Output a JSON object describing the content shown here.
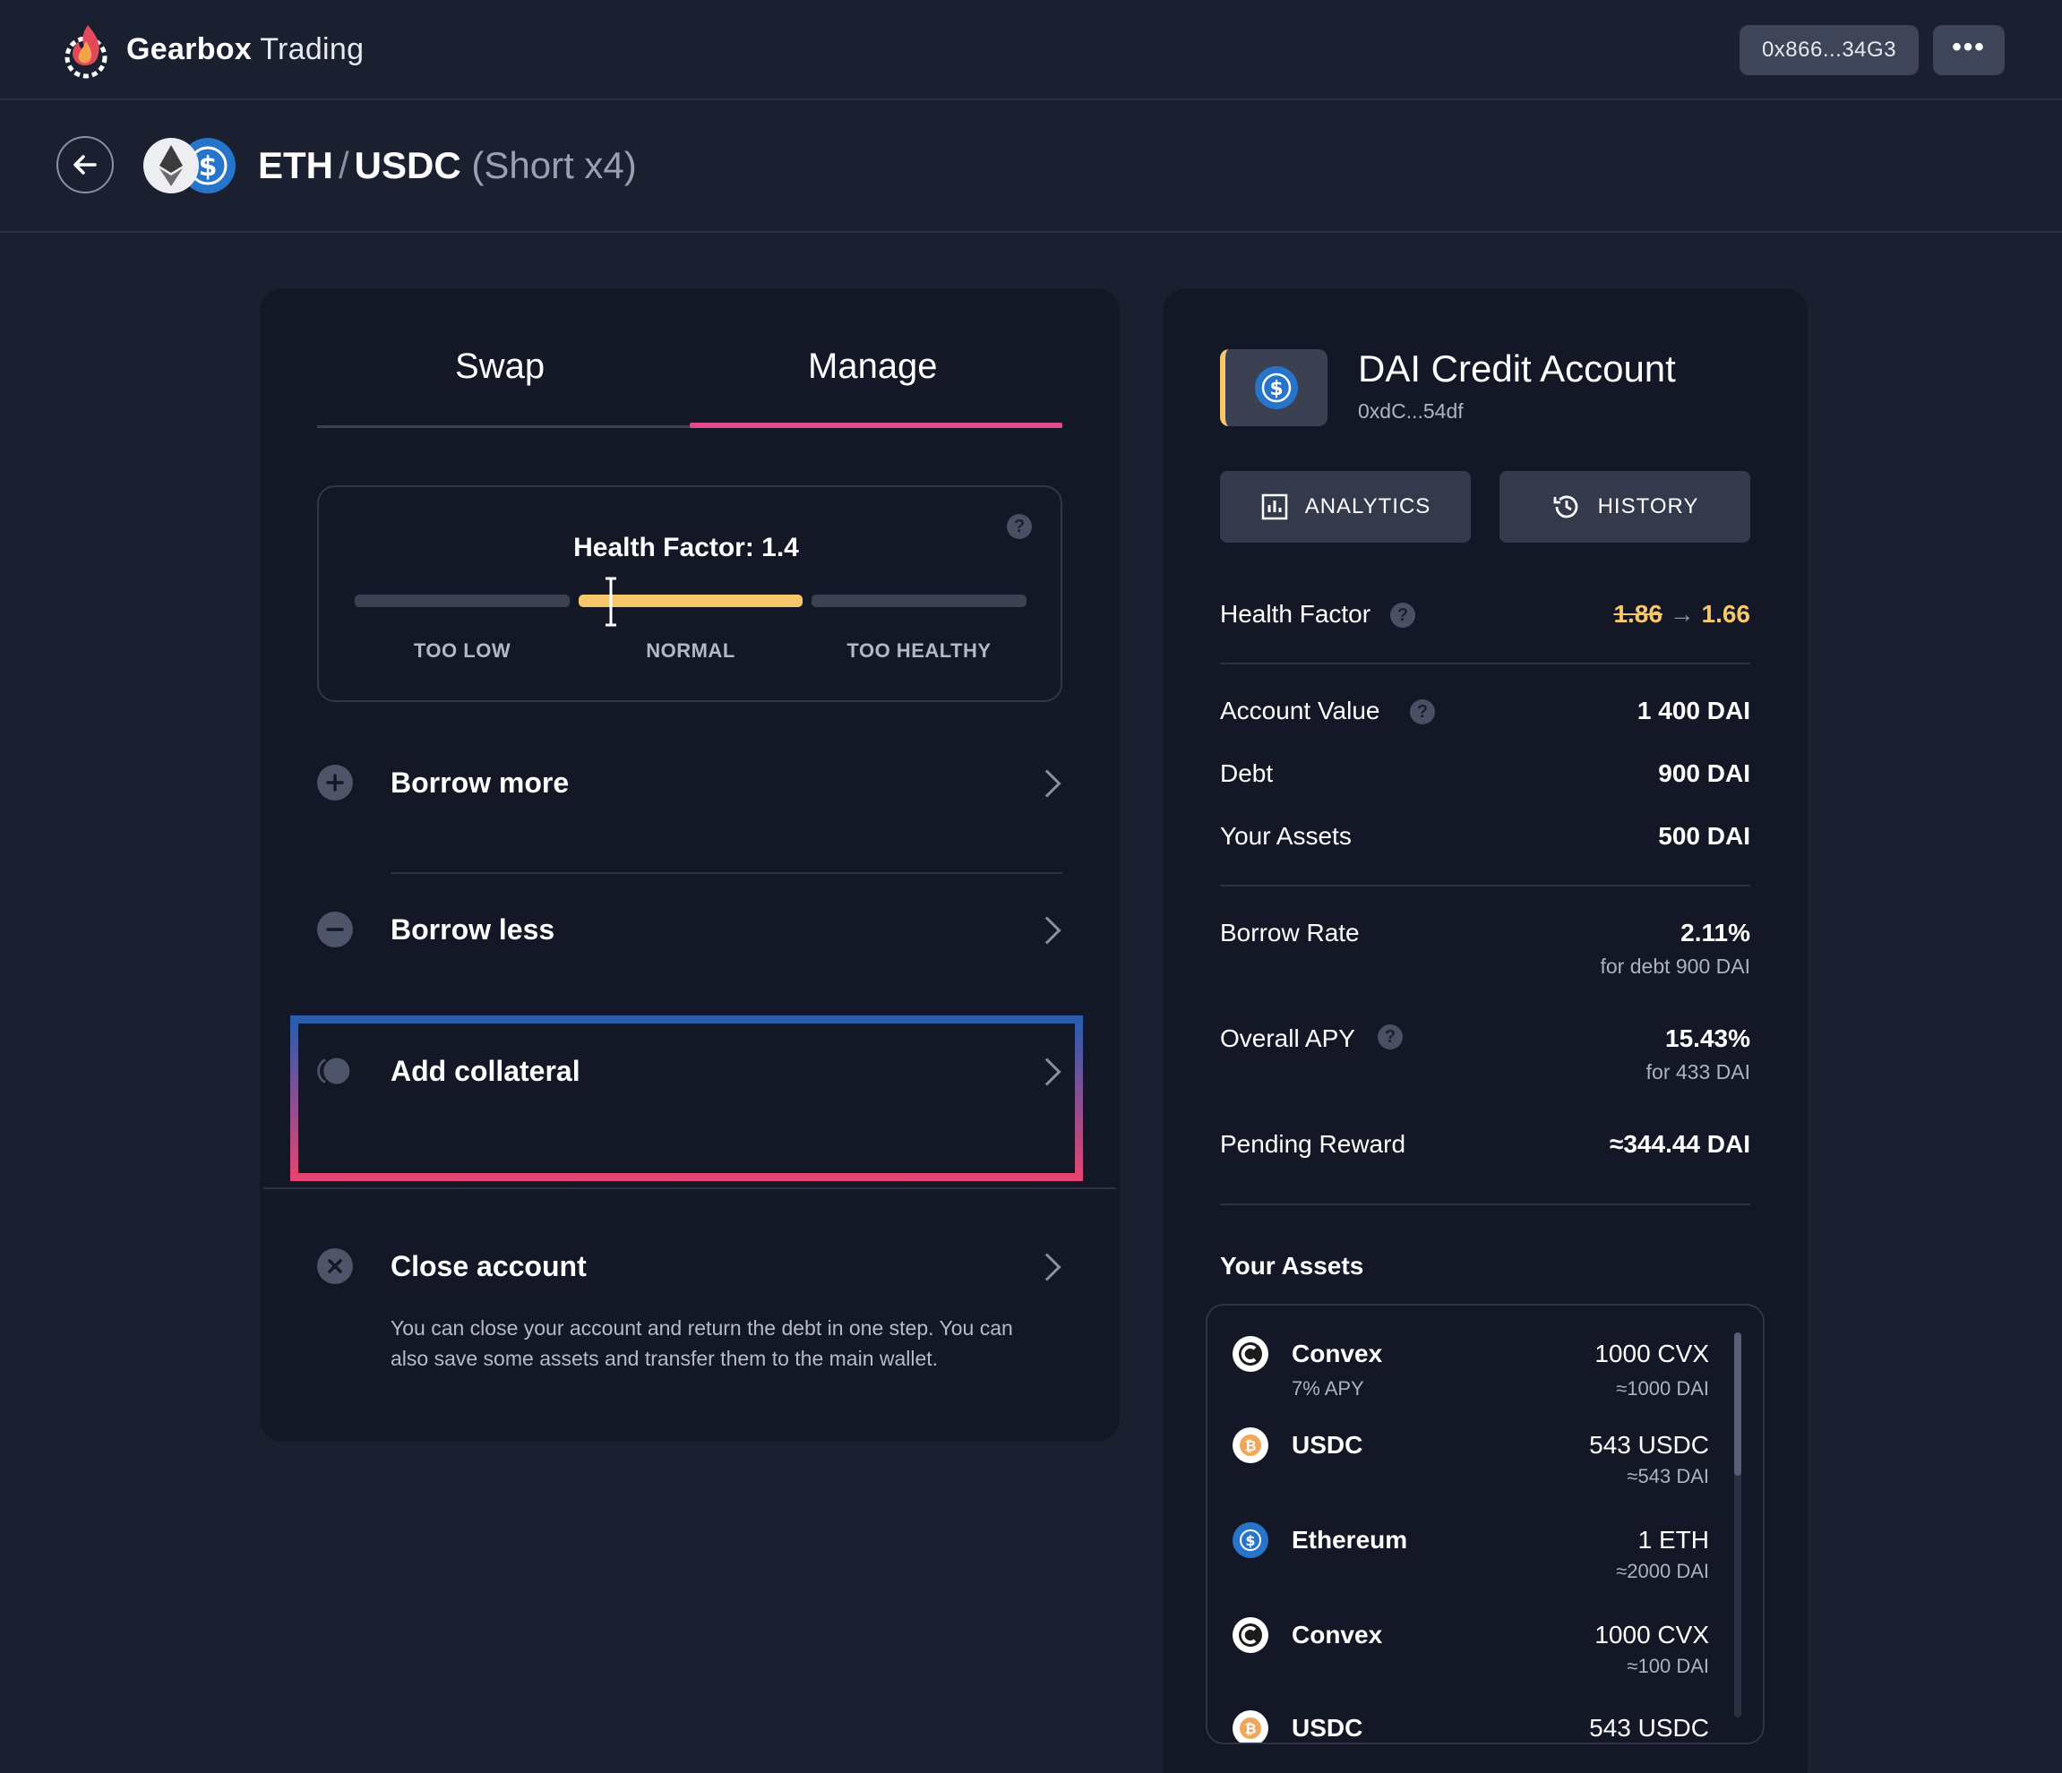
{
  "header": {
    "brand_bold": "Gearbox",
    "brand_light": "Trading",
    "wallet_address": "0x866...34G3",
    "more_label": "•••"
  },
  "pair": {
    "base": "ETH",
    "separator": "/",
    "quote": "USDC",
    "position": "(Short x4)"
  },
  "tabs": [
    {
      "label": "Swap",
      "active": false
    },
    {
      "label": "Manage",
      "active": true
    }
  ],
  "health_factor_widget": {
    "title": "Health Factor: 1.4",
    "value": 1.4,
    "zones": [
      "TOO LOW",
      "NORMAL",
      "TOO HEALTHY"
    ],
    "active_zone": "NORMAL",
    "zone_color": "#f7c76b"
  },
  "actions": [
    {
      "label": "Borrow more",
      "icon": "plus-circle-icon"
    },
    {
      "label": "Borrow less",
      "icon": "minus-circle-icon"
    },
    {
      "label": "Add collateral",
      "icon": "collateral-icon",
      "highlighted": true
    },
    {
      "label": "Close account",
      "icon": "close-circle-icon",
      "description": "You can close your account and return the debt in one step. You can also save some assets and transfer them to the main wallet."
    }
  ],
  "account": {
    "title": "DAI Credit Account",
    "address": "0xdC...54df",
    "analytics_label": "ANALYTICS",
    "history_label": "HISTORY",
    "health_factor": {
      "label": "Health Factor",
      "old": "1.86",
      "arrow": "→",
      "new": "1.66"
    },
    "account_value": {
      "label": "Account Value",
      "value": "1 400 DAI"
    },
    "debt": {
      "label": "Debt",
      "value": "900 DAI"
    },
    "your_assets": {
      "label": "Your Assets",
      "value": "500 DAI"
    },
    "borrow_rate": {
      "label": "Borrow Rate",
      "value": "2.11%",
      "sub": "for debt 900 DAI"
    },
    "overall_apy": {
      "label": "Overall APY",
      "value": "15.43%",
      "sub": "for 433 DAI"
    },
    "pending_reward": {
      "label": "Pending Reward",
      "value": "≈344.44 DAI"
    }
  },
  "assets": {
    "heading": "Your Assets",
    "items": [
      {
        "name": "Convex",
        "sub": "7% APY",
        "amount": "1000 CVX",
        "dai": "≈1000 DAI",
        "icon": "convex-icon"
      },
      {
        "name": "USDC",
        "sub": "",
        "amount": "543 USDC",
        "dai": "≈543 DAI",
        "icon": "bitcoin-icon"
      },
      {
        "name": "Ethereum",
        "sub": "",
        "amount": "1 ETH",
        "dai": "≈2000 DAI",
        "icon": "usdc-icon"
      },
      {
        "name": "Convex",
        "sub": "",
        "amount": "1000 CVX",
        "dai": "≈100 DAI",
        "icon": "convex-icon"
      },
      {
        "name": "USDC",
        "sub": "",
        "amount": "543 USDC",
        "dai": "",
        "icon": "bitcoin-icon"
      }
    ]
  },
  "colors": {
    "accent_pink": "#e24a8a",
    "health_yellow": "#f7c76b",
    "usdc_blue": "#2775ca"
  }
}
